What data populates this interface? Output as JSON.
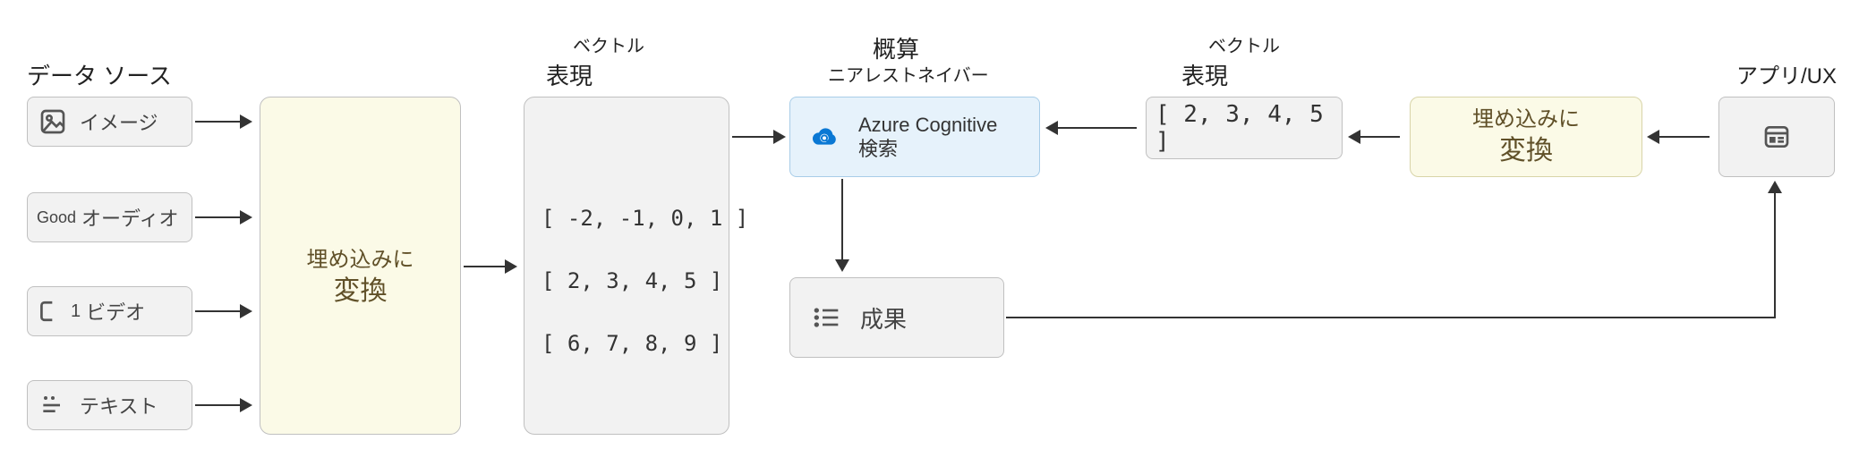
{
  "headers": {
    "data_sources": "データ ソース",
    "vector_small_left": "ベクトル",
    "representation_left": "表現",
    "approx": "概算",
    "ann": "ニアレストネイバー",
    "vector_small_right": "ベクトル",
    "representation_right": "表現",
    "app_ux": "アプリ/UX"
  },
  "sources": {
    "image": "イメージ",
    "audio_prefix": "Good",
    "audio": "オーディオ",
    "video_prefix": "1",
    "video": "ビデオ",
    "text": "テキスト"
  },
  "transform": {
    "line1": "埋め込みに",
    "line2": "変換"
  },
  "vectors_left": {
    "row1": "[ -2, -1, 0, 1  ]",
    "row2": "[  2, 3, 4, 5  ]",
    "row3": "[  6, 7, 8, 9  ]"
  },
  "search": {
    "title": "Azure Cognitive",
    "subtitle": "検索"
  },
  "results": "成果",
  "vector_right": "[  2, 3, 4, 5  ]"
}
